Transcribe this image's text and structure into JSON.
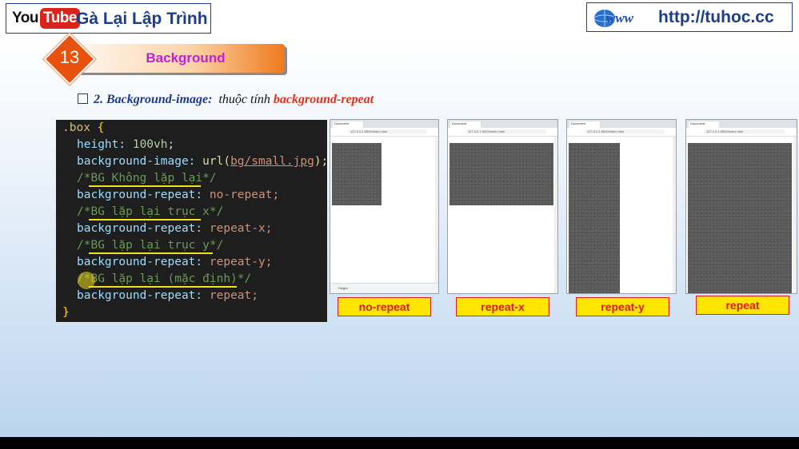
{
  "header": {
    "youtube_you": "You",
    "youtube_tube": "Tube",
    "channel_name": "Gà Lại Lập Trình",
    "www_logo": "www",
    "site_url": "http://tuhoc.cc"
  },
  "lesson": {
    "number": "13",
    "title": "Background"
  },
  "section": {
    "heading_main": "2. Background-image:",
    "heading_middle": "thuộc tính",
    "heading_property": "background-repeat"
  },
  "code": {
    "selector": ".box",
    "open_brace": "{",
    "close_brace": "}",
    "height_prop": "height:",
    "height_val": "100vh",
    "bgimg_prop": "background-image:",
    "bgimg_fn": "url(",
    "bgimg_path": "bg/small.jpg",
    "bgimg_end": ");",
    "comment1": "/*BG Không lặp lại*/",
    "repeat_prop": "background-repeat:",
    "val_norepeat": "no-repeat;",
    "comment2": "/*BG lặp lại trục x*/",
    "val_repeatx": "repeat-x;",
    "comment3": "/*BG lặp lại trục y*/",
    "val_repeaty": "repeat-y;",
    "comment4": "/*BG lặp lại (mặc định)*/",
    "val_repeat": "repeat;",
    "semicolon": ";"
  },
  "browser": {
    "tab_title": "Document",
    "address": "127.0.0.1:5500/index.html",
    "status_text": "Height"
  },
  "captions": {
    "no_repeat": "no-repeat",
    "repeat_x": "repeat-x",
    "repeat_y": "repeat-y",
    "repeat": "repeat"
  },
  "colors": {
    "lesson_badge": "#e8520e",
    "lesson_title": "#c21fd6",
    "heading_blue": "#1d3a8a",
    "heading_red": "#e0321b",
    "caption_fill": "#ffe600",
    "caption_text": "#d42020",
    "editor_bg": "#1e1e1e"
  }
}
